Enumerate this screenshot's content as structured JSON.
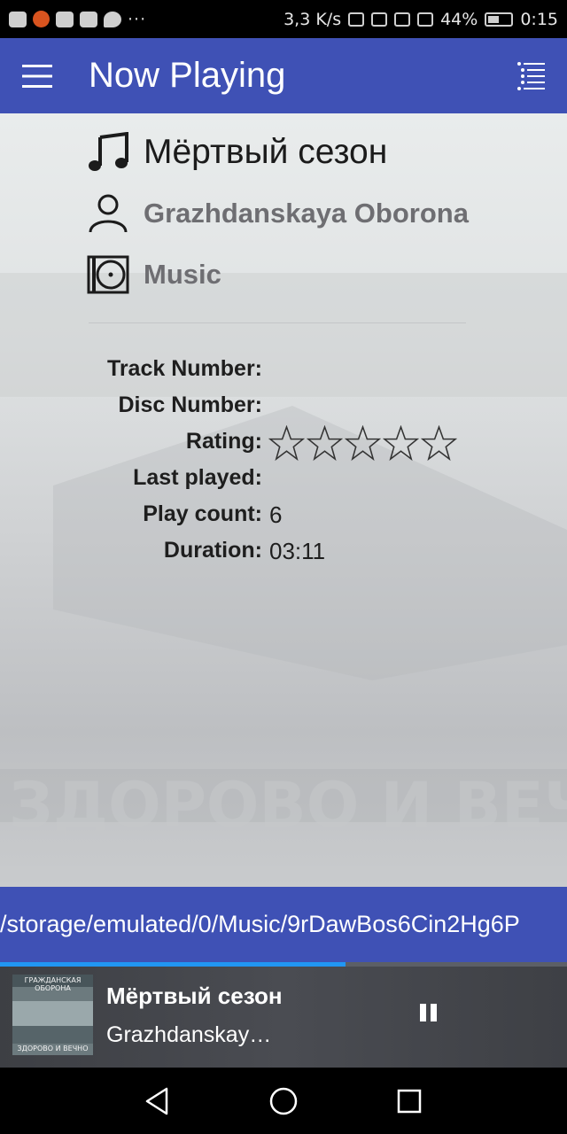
{
  "status_bar": {
    "speed": "3,3 K/s",
    "battery": "44%",
    "time": "0:15",
    "icons": [
      "youtube-icon",
      "app-icon",
      "cat-icon",
      "m-icon",
      "chat-icon",
      "more-icon",
      "hotspot-icon",
      "no-sim-icon",
      "bluetooth-icon",
      "vibrate-icon",
      "eye-icon",
      "signal-icon",
      "battery-icon"
    ],
    "more": "···"
  },
  "app_bar": {
    "title": "Now Playing",
    "menu_icon": "hamburger-icon",
    "queue_icon": "queue-list-icon",
    "color": "#3f51b5"
  },
  "song": {
    "title": "Мёртвый сезон",
    "artist": "Grazhdanskaya Oborona",
    "album": "Music"
  },
  "properties": [
    {
      "key": "Track Number:",
      "value": ""
    },
    {
      "key": "Disc Number:",
      "value": ""
    },
    {
      "key": "Rating:",
      "value": ""
    },
    {
      "key": "Last played:",
      "value": ""
    },
    {
      "key": "Play count:",
      "value": "6"
    },
    {
      "key": "Duration:",
      "value": "03:11"
    }
  ],
  "rating": {
    "stars": 0,
    "max": 5
  },
  "path": "/storage/emulated/0/Music/9rDawBos6Cin2Hg6P",
  "progress": 0.61,
  "mini_player": {
    "title": "Мёртвый сезон",
    "artist": "Grazhdanskay…",
    "cover_top_text": "ГРАЖДАНСКАЯ ОБОРОНА",
    "cover_bottom_text": "ЗДОРОВО И ВЕЧНО",
    "pause_icon": "pause-icon"
  },
  "nav_bar": {
    "back_icon": "back-icon",
    "home_icon": "home-icon",
    "recents_icon": "recents-icon"
  }
}
